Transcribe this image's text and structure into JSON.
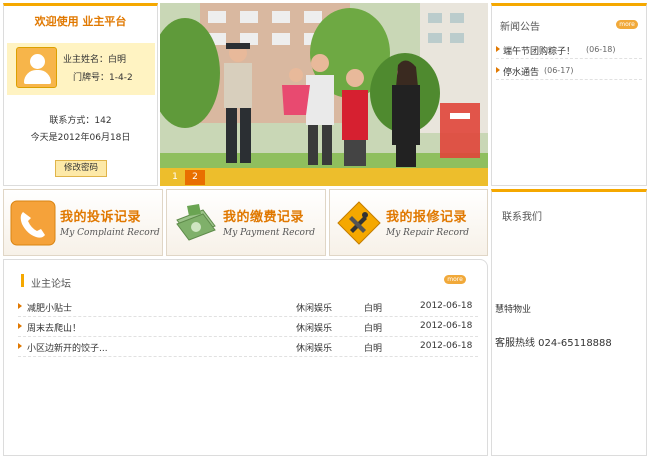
{
  "welcome": {
    "title": "欢迎使用  业主平台",
    "owner_name": "业主姓名：白明",
    "door_no": "门牌号：1-4-2",
    "contact": "联系方式：142",
    "today": "今天是2012年06月18日",
    "change_password": "修改密码"
  },
  "banner": {
    "pages": [
      "1",
      "2"
    ],
    "active_page": "2"
  },
  "news": {
    "title": "新闻公告",
    "more": "more",
    "items": [
      {
        "text": "端午节团购粽子！",
        "date": "(06-18)"
      },
      {
        "text": "停水通告",
        "date": "(06-17)"
      }
    ]
  },
  "records": {
    "complaint": {
      "cn": "我的投诉记录",
      "en": "My Complaint Record",
      "icon": "phone-icon"
    },
    "payment": {
      "cn": "我的缴费记录",
      "en": "My Payment Record",
      "icon": "money-icon"
    },
    "repair": {
      "cn": "我的报修记录",
      "en": "My Repair Record",
      "icon": "tools-icon"
    }
  },
  "forum": {
    "title": "业主论坛",
    "more": "more",
    "rows": [
      {
        "topic": "减肥小贴士",
        "category": "休闲娱乐",
        "author": "白明",
        "date": "2012-06-18"
      },
      {
        "topic": "周末去爬山！",
        "category": "休闲娱乐",
        "author": "白明",
        "date": "2012-06-18"
      },
      {
        "topic": "小区边新开的饺子...",
        "category": "休闲娱乐",
        "author": "白明",
        "date": "2012-06-18"
      }
    ]
  },
  "contact_us": {
    "title": "联系我们",
    "company": "慧特物业",
    "phone": "客服热线  024-65118888"
  },
  "colors": {
    "accent": "#f5a800",
    "title_orange": "#e07800",
    "active_page": "#e96f00"
  }
}
